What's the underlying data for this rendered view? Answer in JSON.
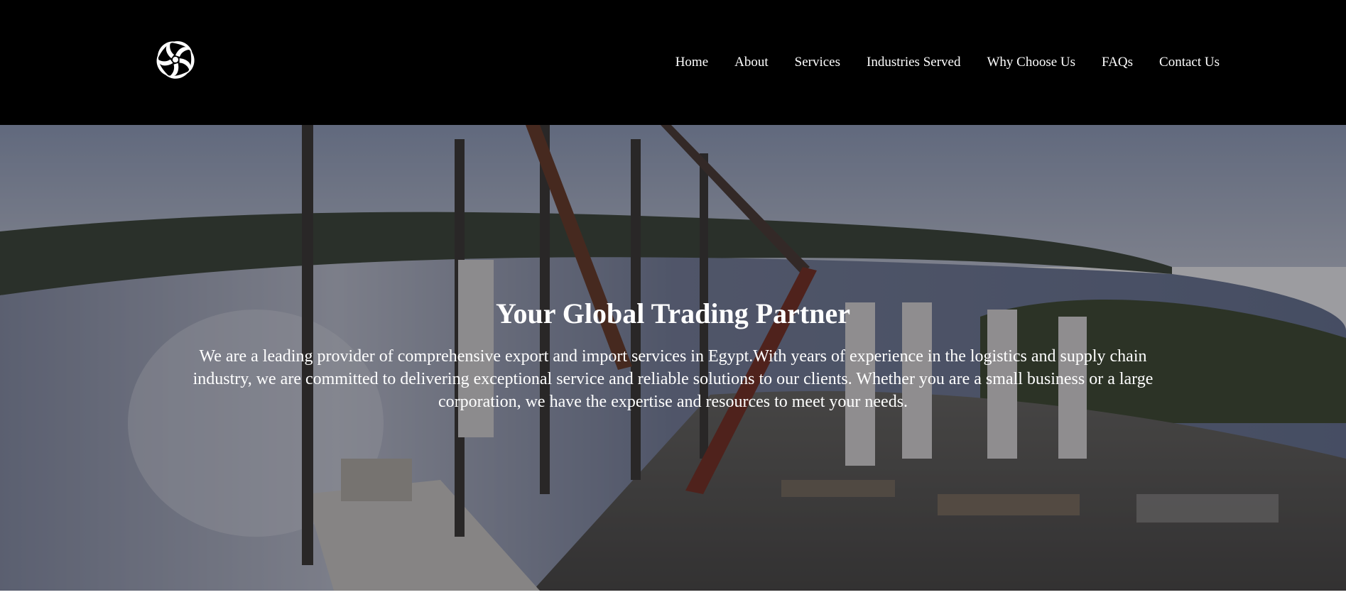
{
  "header": {
    "logo_icon": "flower-swirl-logo-icon",
    "nav": [
      {
        "label": "Home"
      },
      {
        "label": "About"
      },
      {
        "label": "Services"
      },
      {
        "label": "Industries Served"
      },
      {
        "label": "Why Choose Us"
      },
      {
        "label": "FAQs"
      },
      {
        "label": "Contact Us"
      }
    ]
  },
  "hero": {
    "title": "Your Global Trading Partner",
    "text": "We are a leading provider of comprehensive export and import services in Egypt.With years of experience in the logistics and supply chain industry, we are committed to delivering exceptional service and reliable solutions to our clients. Whether you are a small business or a large corporation, we have the expertise and resources to meet your needs.",
    "background": "aerial-port-cranes-wind-turbines-photo"
  },
  "colors": {
    "header_bg": "#000000",
    "text": "#ffffff",
    "page_bg": "#ffffff"
  }
}
